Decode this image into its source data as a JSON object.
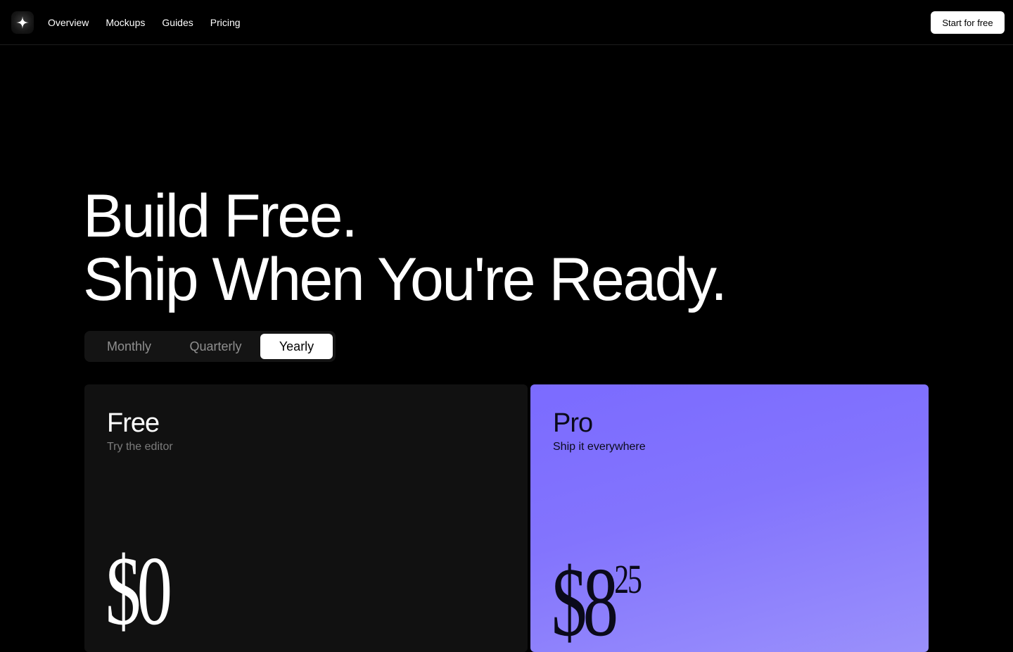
{
  "nav": {
    "links": [
      "Overview",
      "Mockups",
      "Guides",
      "Pricing"
    ],
    "cta_label": "Start for free"
  },
  "hero": {
    "line1": "Build Free.",
    "line2": "Ship When You're Ready."
  },
  "billing_toggle": {
    "options": [
      "Monthly",
      "Quarterly",
      "Yearly"
    ],
    "selected": "Yearly"
  },
  "plans": [
    {
      "name": "Free",
      "subtitle": "Try the editor",
      "price_main": "$0",
      "price_cents": ""
    },
    {
      "name": "Pro",
      "subtitle": "Ship it everywhere",
      "price_main": "$8",
      "price_cents": "25"
    }
  ],
  "colors": {
    "background": "#000000",
    "free_card": "#111111",
    "pro_card_top": "#7b6bff",
    "pro_card_bottom": "#9a90fb",
    "cta_bg": "#ffffff"
  },
  "icons": {
    "logo": "sparkle-star-icon"
  }
}
